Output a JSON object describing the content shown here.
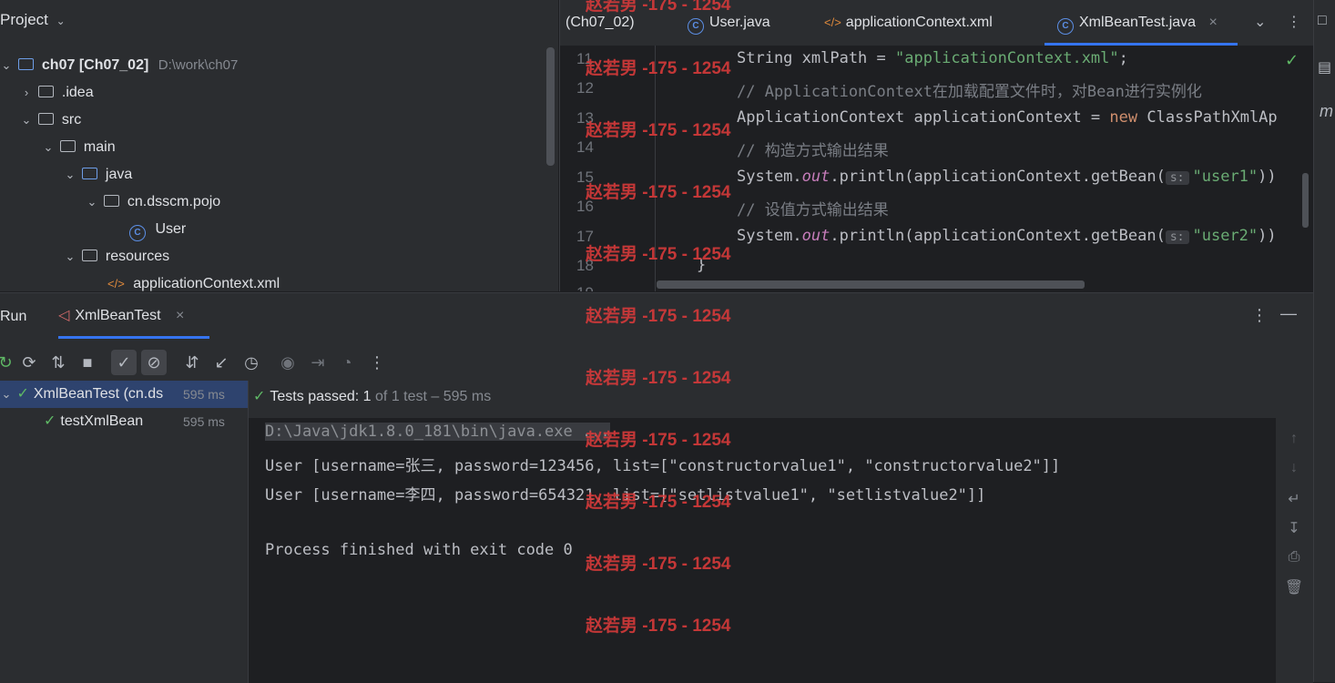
{
  "project_panel": {
    "title": "Project",
    "tree": [
      {
        "label": "ch07",
        "module": "[Ch07_02]",
        "path": "D:\\work\\ch07"
      },
      {
        "label": ".idea"
      },
      {
        "label": "src"
      },
      {
        "label": "main"
      },
      {
        "label": "java"
      },
      {
        "label": "cn.dsscm.pojo"
      },
      {
        "label": "User"
      },
      {
        "label": "resources"
      },
      {
        "label": "applicationContext.xml"
      }
    ]
  },
  "editor": {
    "tabs": [
      {
        "label": "(Ch07_02)"
      },
      {
        "label": "User.java"
      },
      {
        "label": "applicationContext.xml"
      },
      {
        "label": "XmlBeanTest.java"
      }
    ],
    "line_numbers": [
      "11",
      "12",
      "13",
      "14",
      "15",
      "16",
      "17",
      "18",
      "19"
    ],
    "code": {
      "l11_a": "String xmlPath = ",
      "l11_b": "\"applicationContext.xml\"",
      "l11_c": ";",
      "l12": "// ApplicationContext在加载配置文件时，对Bean进行实例化",
      "l13_a": "ApplicationContext applicationContext = ",
      "l13_b": "new",
      "l13_c": " ClassPathXmlAp",
      "l14": "// 构造方式输出结果",
      "l15_a": "System.",
      "l15_b": "out",
      "l15_c": ".println(applicationContext.getBean(",
      "l15_hint": "s:",
      "l15_d": "\"user1\"",
      "l15_e": "))",
      "l16": "// 设值方式输出结果",
      "l17_a": "System.",
      "l17_b": "out",
      "l17_c": ".println(applicationContext.getBean(",
      "l17_hint": "s:",
      "l17_d": "\"user2\"",
      "l17_e": "))",
      "l18": "}",
      "l19": "}"
    }
  },
  "run_panel": {
    "title": "Run",
    "tab_label": "XmlBeanTest",
    "tests": [
      {
        "name": "XmlBeanTest (cn.ds",
        "time": "595 ms"
      },
      {
        "name": "testXmlBean",
        "time": "595 ms"
      }
    ],
    "status": {
      "passed": "Tests passed: 1",
      "detail": "of 1 test – 595 ms"
    },
    "console": [
      "D:\\Java\\jdk1.8.0_181\\bin\\java.exe ...",
      "User [username=张三, password=123456, list=[\"constructorvalue1\", \"constructorvalue2\"]]",
      "User [username=李四, password=654321, list=[\"setlistvalue1\", \"setlistvalue2\"]]",
      "",
      "Process finished with exit code 0"
    ]
  },
  "watermark": "赵若男 -175 - 1254",
  "colors": {
    "accent": "#3574f0",
    "pass": "#5fb865",
    "watermark": "#d63a3a"
  }
}
